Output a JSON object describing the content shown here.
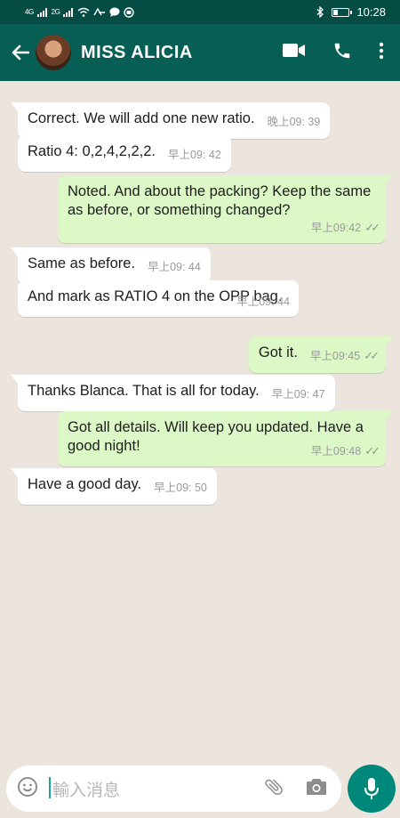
{
  "status_bar": {
    "network_left": "4G",
    "network_right": "2G",
    "time": "10:28"
  },
  "header": {
    "contact_name": "MISS ALICIA",
    "icons": [
      "back-arrow-icon",
      "video-call-icon",
      "phone-icon",
      "more-vert-icon"
    ]
  },
  "messages": [
    {
      "direction": "in",
      "text": "Correct. We will add one new ratio.",
      "time": "晚上09: 39"
    },
    {
      "direction": "in",
      "text": "Ratio 4: 0,2,4,2,2,2.",
      "time": "早上09: 42"
    },
    {
      "direction": "out",
      "text": "Noted. And about the packing? Keep the same as before, or something changed?",
      "time": "早上09:42",
      "status": "read"
    },
    {
      "direction": "in",
      "text": "Same as before.",
      "time": "早上09: 44"
    },
    {
      "direction": "in",
      "text": "And mark as RATIO 4 on the OPP bag.",
      "time": "早上09: 44"
    },
    {
      "direction": "out",
      "text": "Got it.",
      "time": "早上09:45",
      "status": "read"
    },
    {
      "direction": "in",
      "text": "Thanks Blanca. That is all for today.",
      "time": "早上09: 47"
    },
    {
      "direction": "out",
      "text": "Got all details. Will keep you updated. Have a good night!",
      "time": "早上09:48",
      "status": "read"
    },
    {
      "direction": "in",
      "text": "Have a good day.",
      "time": "早上09: 50"
    }
  ],
  "composer": {
    "placeholder": "輸入消息",
    "icons": [
      "emoji-icon",
      "attach-icon",
      "camera-icon",
      "mic-icon"
    ]
  },
  "colors": {
    "header": "#075e54",
    "status_bar": "#054d44",
    "background": "#ece5dd",
    "outgoing_bubble": "#dcf8c6",
    "incoming_bubble": "#ffffff",
    "mic_button": "#00897b"
  }
}
